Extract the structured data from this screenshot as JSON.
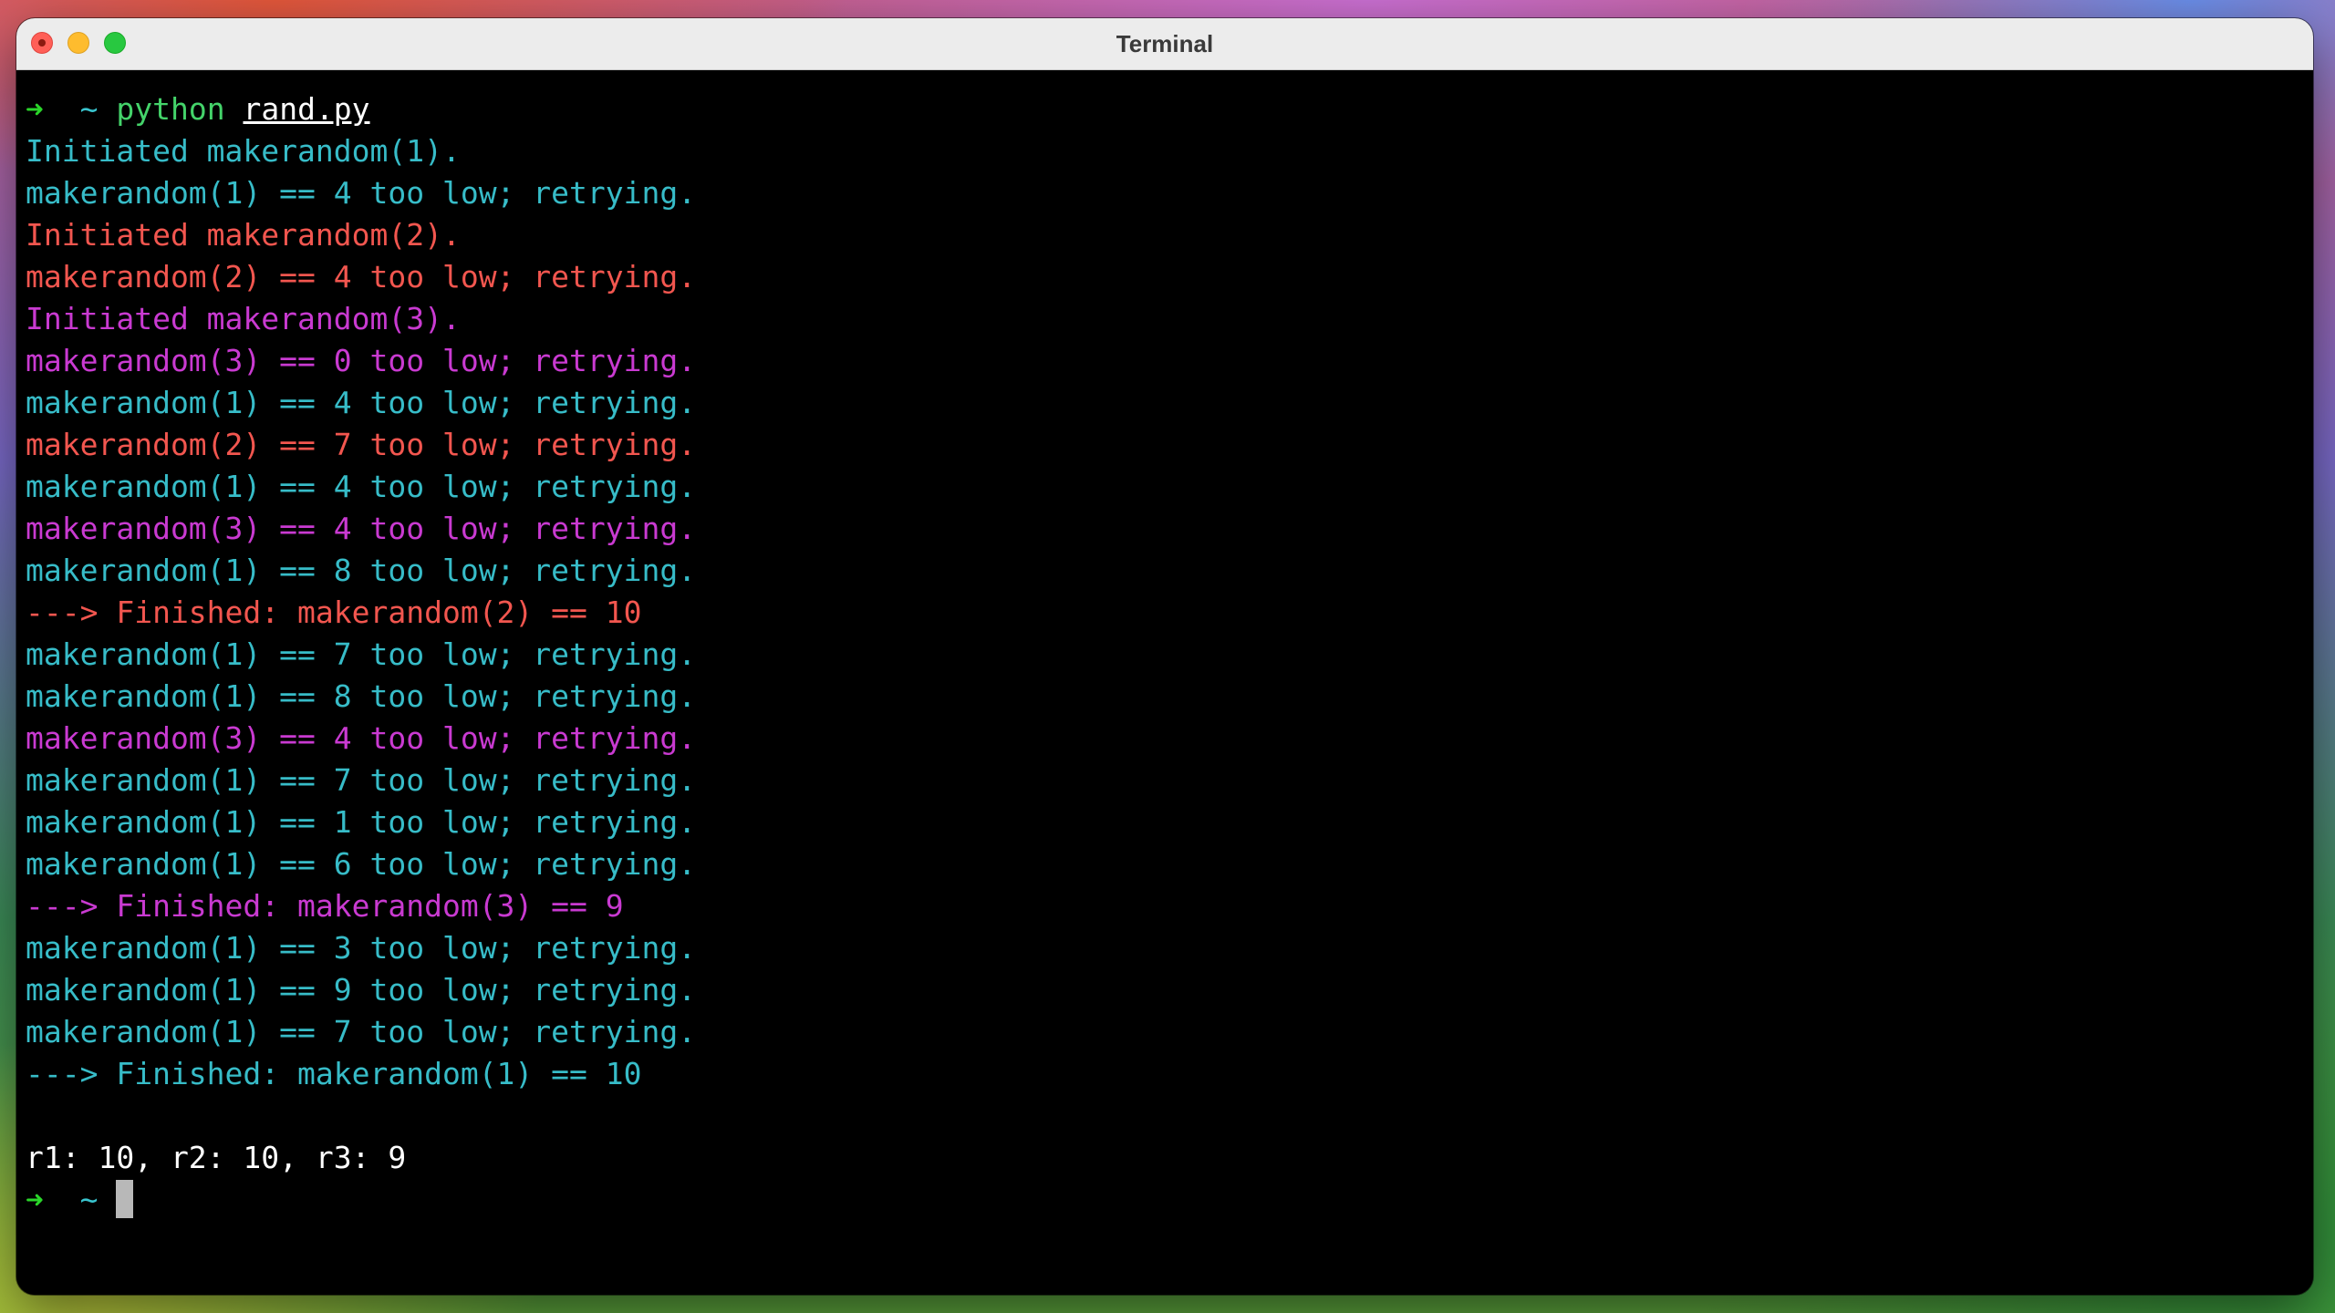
{
  "window": {
    "title": "Terminal"
  },
  "colors": {
    "teal": "#37bcc8",
    "red": "#f2564f",
    "magenta": "#c93ad1",
    "white": "#ffffff",
    "prompt_arrow": "#2ad62a",
    "command": "#44d36a"
  },
  "terminal": {
    "prompt": {
      "arrow": "➜",
      "dir": "~",
      "command": "python",
      "arg": "rand.py"
    },
    "lines": [
      {
        "text": "Initiated makerandom(1).",
        "color": "#37bcc8"
      },
      {
        "text": "makerandom(1) == 4 too low; retrying.",
        "color": "#37bcc8"
      },
      {
        "text": "Initiated makerandom(2).",
        "color": "#f2564f"
      },
      {
        "text": "makerandom(2) == 4 too low; retrying.",
        "color": "#f2564f"
      },
      {
        "text": "Initiated makerandom(3).",
        "color": "#c93ad1"
      },
      {
        "text": "makerandom(3) == 0 too low; retrying.",
        "color": "#c93ad1"
      },
      {
        "text": "makerandom(1) == 4 too low; retrying.",
        "color": "#37bcc8"
      },
      {
        "text": "makerandom(2) == 7 too low; retrying.",
        "color": "#f2564f"
      },
      {
        "text": "makerandom(1) == 4 too low; retrying.",
        "color": "#37bcc8"
      },
      {
        "text": "makerandom(3) == 4 too low; retrying.",
        "color": "#c93ad1"
      },
      {
        "text": "makerandom(1) == 8 too low; retrying.",
        "color": "#37bcc8"
      },
      {
        "text": "---> Finished: makerandom(2) == 10",
        "color": "#f2564f"
      },
      {
        "text": "makerandom(1) == 7 too low; retrying.",
        "color": "#37bcc8"
      },
      {
        "text": "makerandom(1) == 8 too low; retrying.",
        "color": "#37bcc8"
      },
      {
        "text": "makerandom(3) == 4 too low; retrying.",
        "color": "#c93ad1"
      },
      {
        "text": "makerandom(1) == 7 too low; retrying.",
        "color": "#37bcc8"
      },
      {
        "text": "makerandom(1) == 1 too low; retrying.",
        "color": "#37bcc8"
      },
      {
        "text": "makerandom(1) == 6 too low; retrying.",
        "color": "#37bcc8"
      },
      {
        "text": "---> Finished: makerandom(3) == 9",
        "color": "#c93ad1"
      },
      {
        "text": "makerandom(1) == 3 too low; retrying.",
        "color": "#37bcc8"
      },
      {
        "text": "makerandom(1) == 9 too low; retrying.",
        "color": "#37bcc8"
      },
      {
        "text": "makerandom(1) == 7 too low; retrying.",
        "color": "#37bcc8"
      },
      {
        "text": "---> Finished: makerandom(1) == 10",
        "color": "#37bcc8"
      },
      {
        "text": "",
        "color": "#ffffff"
      },
      {
        "text": "r1: 10, r2: 10, r3: 9",
        "color": "#ffffff"
      }
    ],
    "final_prompt": {
      "arrow": "➜",
      "dir": "~"
    }
  }
}
